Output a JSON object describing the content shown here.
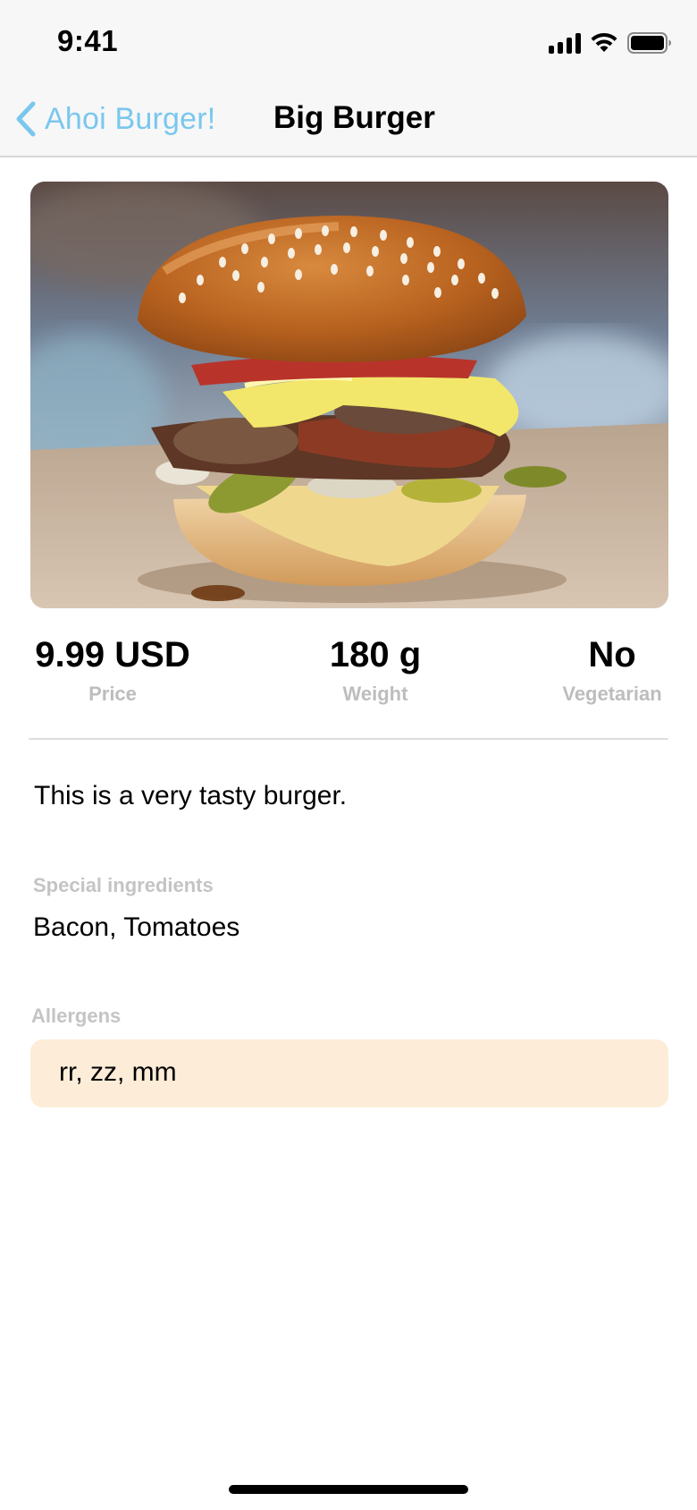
{
  "status_bar": {
    "time": "9:41",
    "icons": [
      "signal-icon",
      "wifi-icon",
      "battery-icon"
    ]
  },
  "nav": {
    "back_label": "Ahoi Burger!",
    "back_icon": "chevron-left-icon",
    "title": "Big Burger",
    "accent_color": "#7ac7ee"
  },
  "stats": {
    "price": {
      "value": "9.99 USD",
      "label": "Price"
    },
    "weight": {
      "value": "180 g",
      "label": "Weight"
    },
    "vegetarian": {
      "value": "No",
      "label": "Vegetarian"
    }
  },
  "description": "This is a very tasty burger.",
  "special_ingredients": {
    "label": "Special ingredients",
    "value": "Bacon, Tomatoes"
  },
  "allergens": {
    "label": "Allergens",
    "value": "rr, zz, mm",
    "background_color": "#fdecd8"
  }
}
